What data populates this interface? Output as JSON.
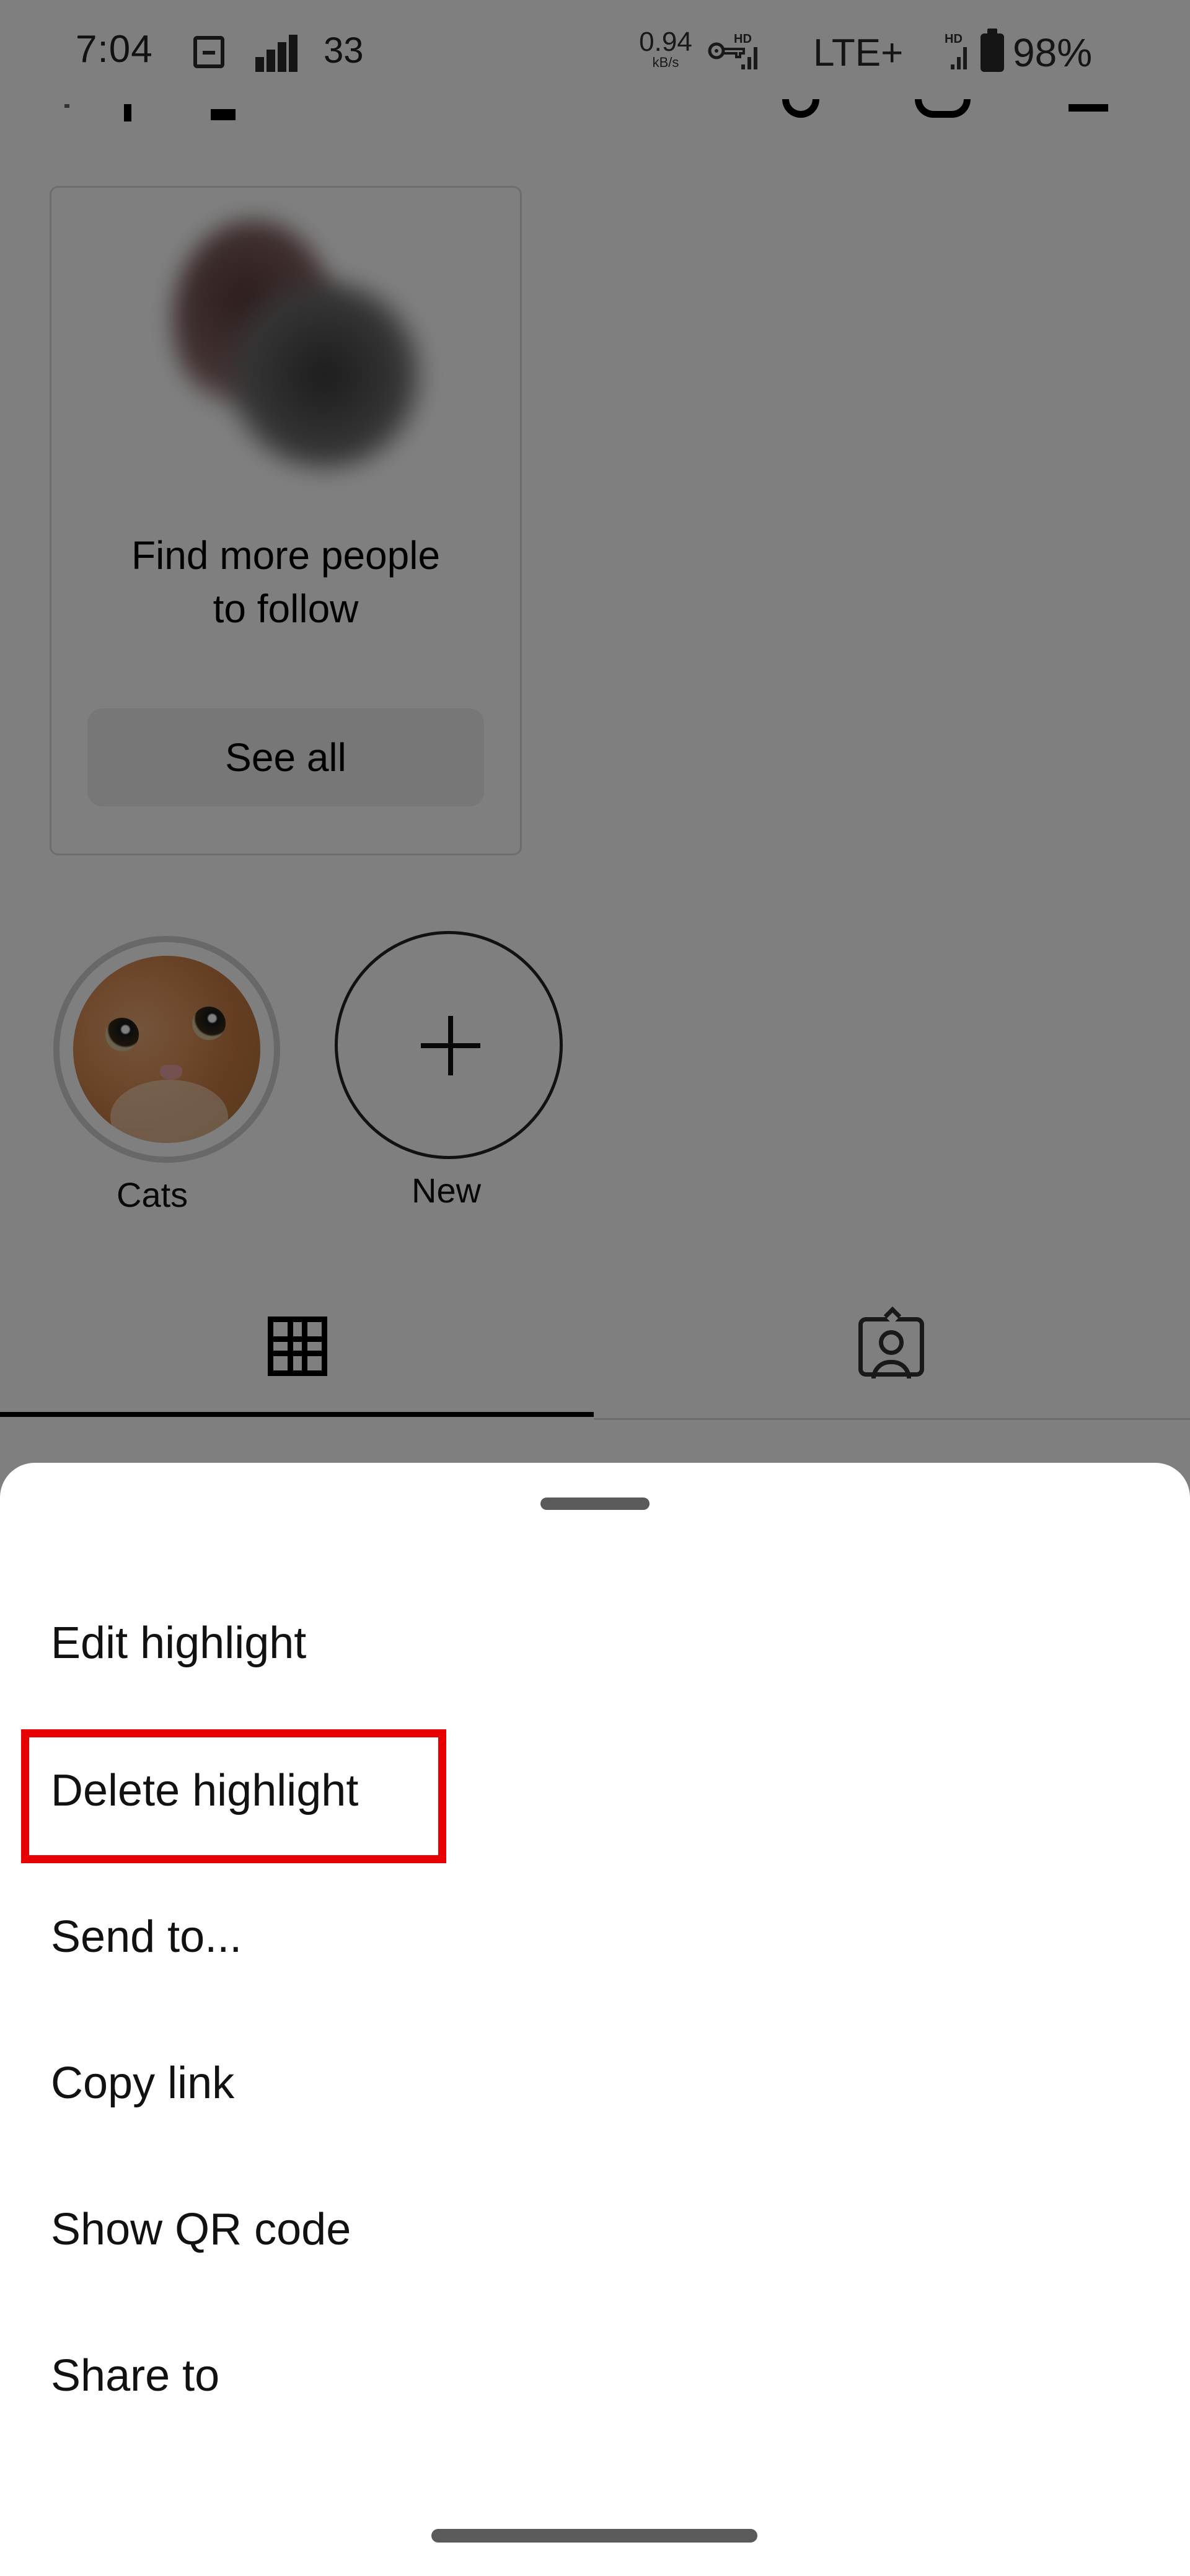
{
  "status_bar": {
    "time": "7:04",
    "notification_count": "33",
    "net_speed_value": "0.94",
    "net_speed_unit": "kB/s",
    "hd_label_1": "HD",
    "network_type": "LTE+",
    "hd_label_2": "HD",
    "battery_percent": "98%",
    "icons": [
      "gallery-icon",
      "signal-icon",
      "vpn-key-icon",
      "hd-signal-icon",
      "hd-signal-icon",
      "battery-icon"
    ]
  },
  "suggestion_card": {
    "title": "Find more people to follow",
    "button_label": "See all"
  },
  "highlights": [
    {
      "label": "Cats",
      "icon": "cat-photo"
    },
    {
      "label": "New",
      "icon": "plus-icon"
    }
  ],
  "profile_tabs": [
    {
      "name": "posts-grid",
      "icon": "grid-icon",
      "selected": true
    },
    {
      "name": "tagged",
      "icon": "tagged-person-icon",
      "selected": false
    }
  ],
  "bottom_sheet": {
    "items": [
      {
        "label": "Edit highlight"
      },
      {
        "label": "Delete highlight",
        "annotated": true
      },
      {
        "label": "Send to..."
      },
      {
        "label": "Copy link"
      },
      {
        "label": "Show QR code"
      },
      {
        "label": "Share to"
      }
    ]
  },
  "colors": {
    "annotation": "#e80000",
    "scrim": "rgba(0,0,0,0.5)",
    "sheet_background": "#ffffff"
  }
}
